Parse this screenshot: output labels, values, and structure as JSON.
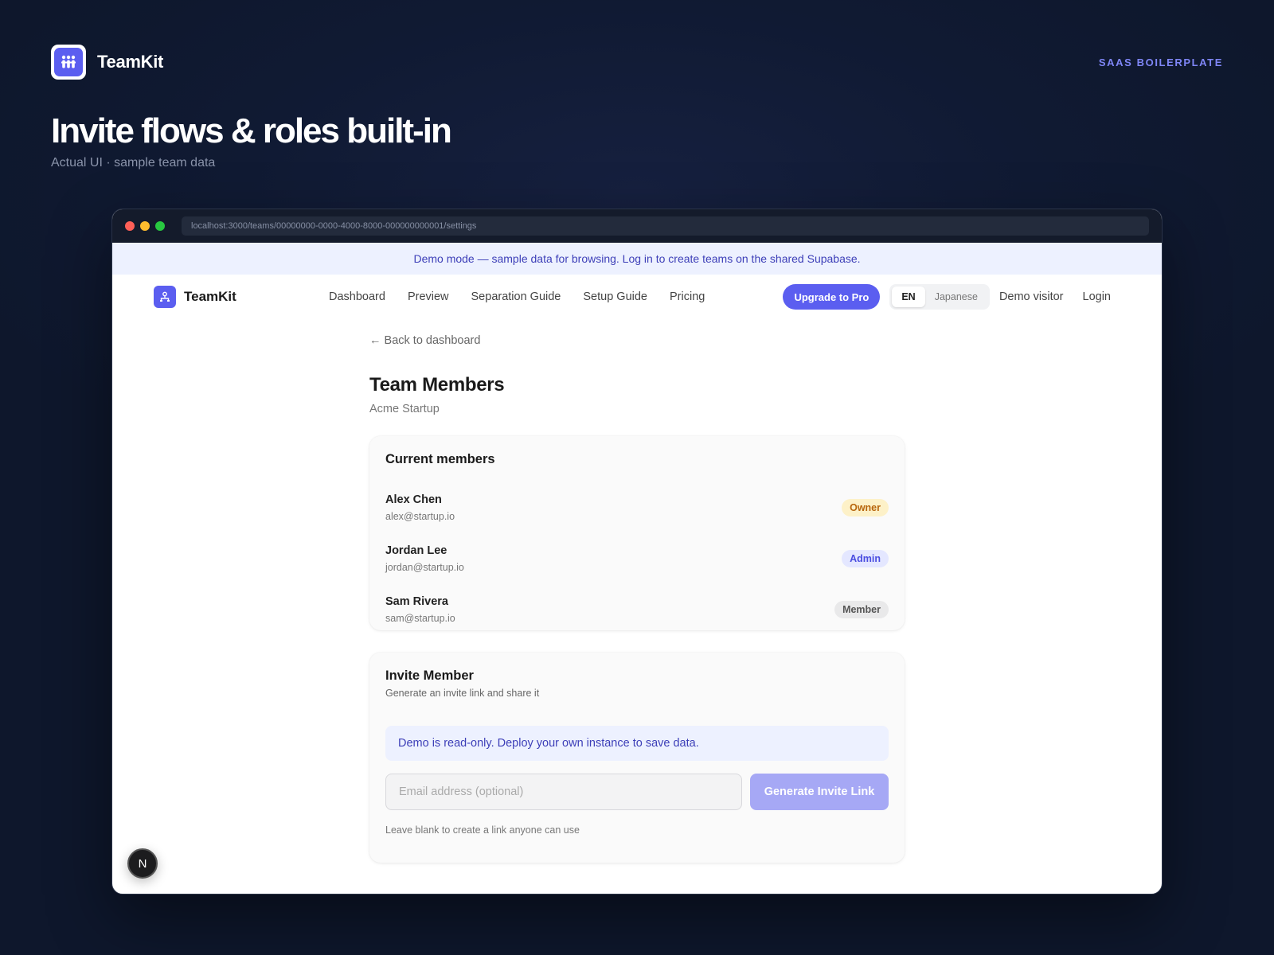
{
  "brand": {
    "name": "TeamKit",
    "tagline": "SAAS BOILERPLATE",
    "logo_icon": "team-icon"
  },
  "hero": {
    "title": "Invite flows & roles built-in",
    "subtitle": "Actual UI · sample team data"
  },
  "window": {
    "url": "localhost:3000/teams/00000000-0000-4000-8000-000000000001/settings",
    "traffic_lights": [
      "#ff5f57",
      "#febc2e",
      "#28c840"
    ]
  },
  "demo_banner": "Demo mode — sample data for browsing. Log in to create teams on the shared Supabase.",
  "nav": {
    "logo_name": "TeamKit",
    "links": [
      "Dashboard",
      "Preview",
      "Separation Guide",
      "Setup Guide",
      "Pricing"
    ],
    "upgrade_label": "Upgrade to Pro",
    "languages": [
      "EN",
      "Japanese"
    ],
    "active_language": "EN",
    "user_label": "Demo visitor",
    "login_label": "Login"
  },
  "page": {
    "back_label": "← Back to dashboard",
    "title": "Team Members",
    "team_name": "Acme Startup"
  },
  "members_card": {
    "title": "Current members",
    "members": [
      {
        "name": "Alex Chen",
        "email": "alex@startup.io",
        "role": "Owner"
      },
      {
        "name": "Jordan Lee",
        "email": "jordan@startup.io",
        "role": "Admin"
      },
      {
        "name": "Sam Rivera",
        "email": "sam@startup.io",
        "role": "Member"
      }
    ]
  },
  "invite_card": {
    "title": "Invite Member",
    "subtitle": "Generate an invite link and share it",
    "notice": "Demo is read-only. Deploy your own instance to save data.",
    "email_placeholder": "Email address (optional)",
    "email_value": "",
    "generate_label": "Generate Invite Link",
    "hint": "Leave blank to create a link anyone can use"
  },
  "dev_badge": "N",
  "colors": {
    "accent": "#5b5ef0",
    "background": "#0f182e",
    "tagline": "#7f86f7"
  }
}
